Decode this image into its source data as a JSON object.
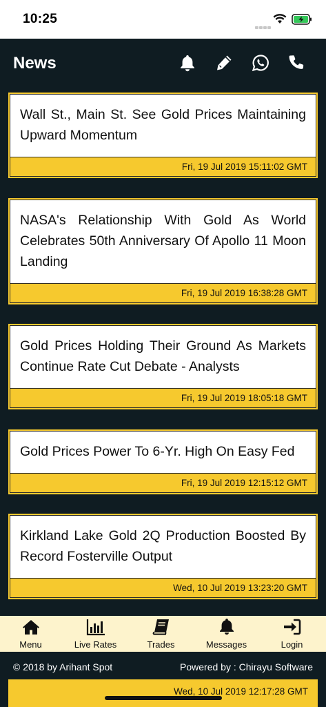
{
  "status_bar": {
    "time": "10:25"
  },
  "header": {
    "title": "News",
    "icons": [
      "bell-icon",
      "pencil-icon",
      "whatsapp-icon",
      "phone-icon"
    ]
  },
  "news": [
    {
      "title": "Wall St., Main St. See Gold Prices Maintaining Upward Momentum",
      "date": "Fri, 19 Jul 2019 15:11:02 GMT"
    },
    {
      "title": "NASA's Relationship With Gold As World Celebrates 50th Anniversary Of Apollo 11 Moon Landing",
      "date": "Fri, 19 Jul 2019 16:38:28 GMT"
    },
    {
      "title": "Gold Prices Holding Their Ground As Markets Continue Rate Cut Debate - Analysts",
      "date": "Fri, 19 Jul 2019 18:05:18 GMT"
    },
    {
      "title": "Gold Prices Power To 6-Yr. High On Easy Fed",
      "date": "Fri, 19 Jul 2019 12:15:12 GMT"
    },
    {
      "title": "Kirkland Lake Gold 2Q Production Boosted By Record Fosterville Output",
      "date": "Wed, 10 Jul 2019 13:23:20 GMT"
    },
    {
      "title": "",
      "date": "Wed, 10 Jul 2019 12:17:28 GMT"
    }
  ],
  "tabs": [
    {
      "label": "Menu",
      "icon": "home-icon"
    },
    {
      "label": "Live Rates",
      "icon": "bar-chart-icon"
    },
    {
      "label": "Trades",
      "icon": "book-icon"
    },
    {
      "label": "Messages",
      "icon": "bell-icon"
    },
    {
      "label": "Login",
      "icon": "sign-in-icon"
    }
  ],
  "footer": {
    "copyright": "© 2018 by Arihant Spot",
    "powered_by": "Powered by : Chirayu Software"
  },
  "colors": {
    "background": "#0f1c22",
    "accent": "#f6c92e",
    "tab_bar": "#fdf3cc"
  }
}
